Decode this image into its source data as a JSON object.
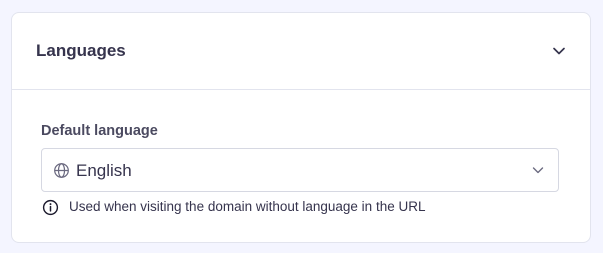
{
  "section": {
    "title": "Languages",
    "toggle_icon": "chevron-down-icon"
  },
  "default_language": {
    "label": "Default language",
    "selected_value": "English",
    "leading_icon": "globe-icon",
    "trailing_icon": "chevron-down-icon",
    "hint": "Used when visiting the domain without language in the URL",
    "hint_icon": "info-icon"
  },
  "colors": {
    "page_background": "#f4f5ff",
    "card_background": "#ffffff",
    "border": "#e2e4ee",
    "text_primary": "#36344d"
  }
}
